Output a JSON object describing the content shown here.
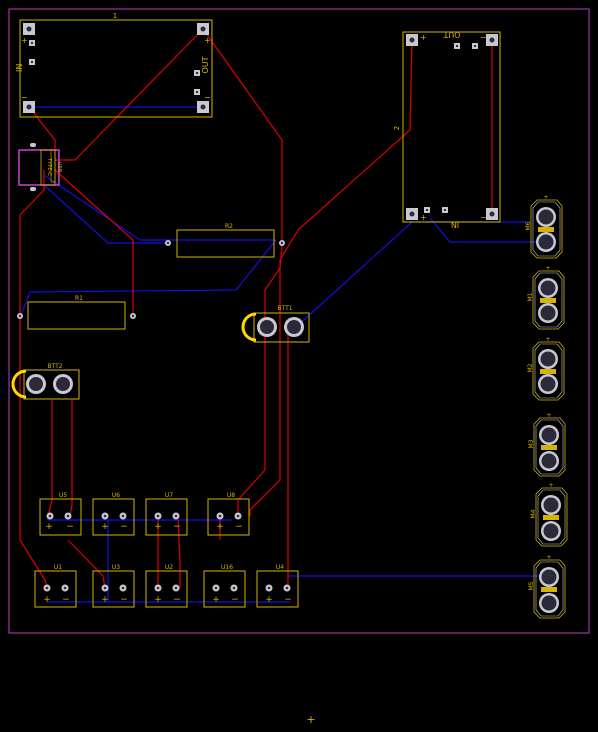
{
  "board": {
    "colors": {
      "background": "#000000",
      "board_outline": "#c040c0",
      "silkscreen": "#d4b400",
      "copper_top": "#e00000",
      "copper_bottom": "#1010e0",
      "pad_fill": "#c8c8d0",
      "hole": "#2a2a3a",
      "battery_mark": "#ffd800",
      "usb_body": "#d040d0"
    },
    "labels": {
      "module1_ref": "1",
      "module1_in": "IN",
      "module1_out": "OUT",
      "module2_ref": "2",
      "module2_in": "IN",
      "module2_out": "OUT",
      "usb_ref": "USB",
      "usb_text": "TYPE-C",
      "r1": "R1",
      "r2": "R2",
      "btt1": "BTT1",
      "btt2": "BTT2",
      "u5": "U5",
      "u6": "U6",
      "u7": "U7",
      "u8": "U8",
      "u1": "U1",
      "u3": "U3",
      "u2": "U2",
      "u16": "U16",
      "u4": "U4",
      "m6": "M6",
      "m1": "M1",
      "m2": "M2",
      "m3": "M3",
      "m4": "M4",
      "m5": "M5",
      "plus": "+",
      "minus": "−"
    }
  }
}
